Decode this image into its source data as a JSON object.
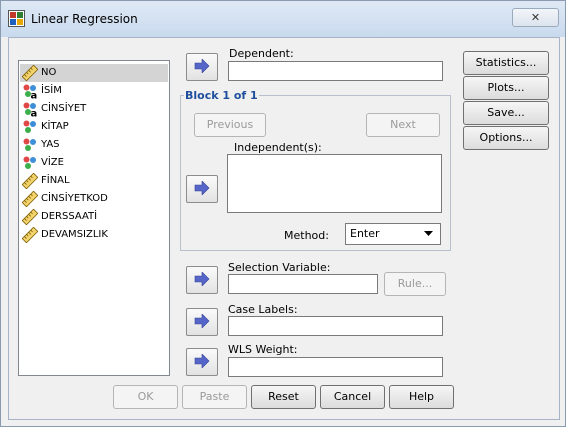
{
  "window": {
    "title": "Linear Regression",
    "close_label": "✕"
  },
  "variables": [
    {
      "label": "NO",
      "icon": "ruler-icon",
      "selected": true
    },
    {
      "label": "İSİM",
      "icon": "nominal-string-icon",
      "selected": false
    },
    {
      "label": "CİNSİYET",
      "icon": "nominal-string-icon",
      "selected": false
    },
    {
      "label": "KİTAP",
      "icon": "nominal-icon",
      "selected": false
    },
    {
      "label": "YAS",
      "icon": "nominal-icon",
      "selected": false
    },
    {
      "label": "VİZE",
      "icon": "nominal-icon",
      "selected": false
    },
    {
      "label": "FİNAL",
      "icon": "ruler-icon",
      "selected": false
    },
    {
      "label": "CİNSİYETKOD",
      "icon": "ruler-icon",
      "selected": false
    },
    {
      "label": "DERSSAATİ",
      "icon": "ruler-icon",
      "selected": false
    },
    {
      "label": "DEVAMSIZLIK",
      "icon": "ruler-icon",
      "selected": false
    }
  ],
  "dependent": {
    "label": "Dependent:",
    "value": ""
  },
  "block": {
    "title": "Block 1 of 1",
    "previous_label": "Previous",
    "next_label": "Next",
    "independents_label": "Independent(s):",
    "method_label": "Method:",
    "method_value": "Enter"
  },
  "selection": {
    "label": "Selection Variable:",
    "rule_label": "Rule..."
  },
  "case_labels": {
    "label": "Case Labels:"
  },
  "wls": {
    "label": "WLS Weight:"
  },
  "side_buttons": {
    "statistics": "Statistics...",
    "plots": "Plots...",
    "save": "Save...",
    "options": "Options..."
  },
  "bottom_buttons": {
    "ok": "OK",
    "paste": "Paste",
    "reset": "Reset",
    "cancel": "Cancel",
    "help": "Help"
  },
  "colors": {
    "arrow": "#5566c8",
    "block_title": "#1f4e9c",
    "selected_row": "#d4d4d4"
  }
}
